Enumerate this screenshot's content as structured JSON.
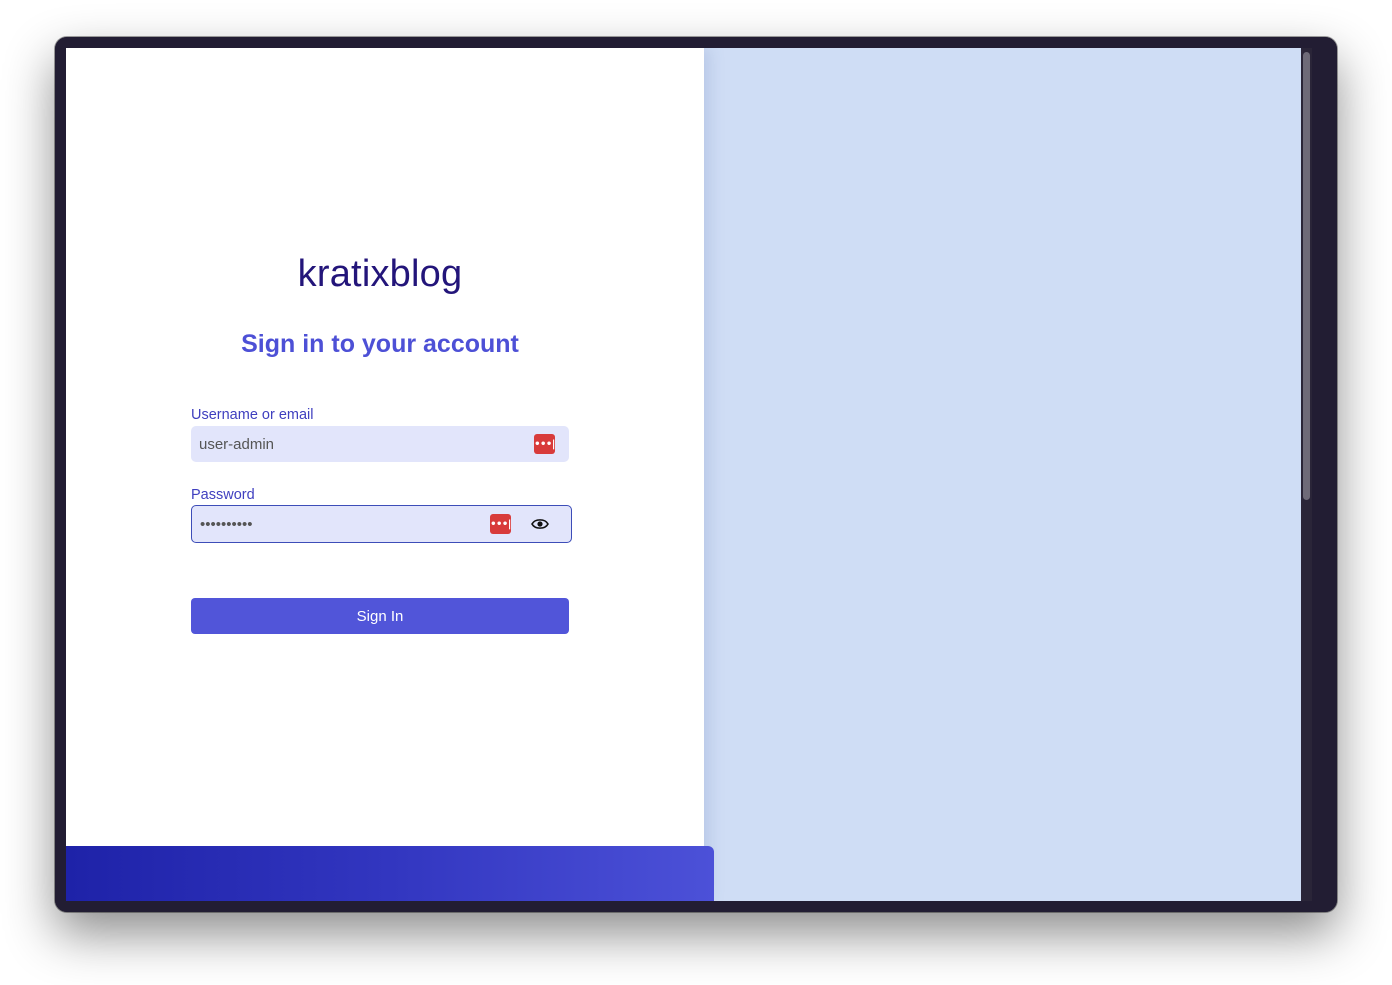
{
  "brand": {
    "name": "kratixblog"
  },
  "form": {
    "heading": "Sign in to your account",
    "username": {
      "label": "Username or email",
      "value": "user-admin"
    },
    "password": {
      "label": "Password",
      "value": "••••••••••"
    },
    "submit_label": "Sign In"
  },
  "icons": {
    "password_manager": "password-manager-icon",
    "show_password": "eye-icon"
  },
  "colors": {
    "brand_text": "#23157a",
    "accent": "#5155d9",
    "field_bg": "#e2e5fb",
    "right_panel_bg": "#cfddf5",
    "password_manager": "#d83b3b"
  }
}
